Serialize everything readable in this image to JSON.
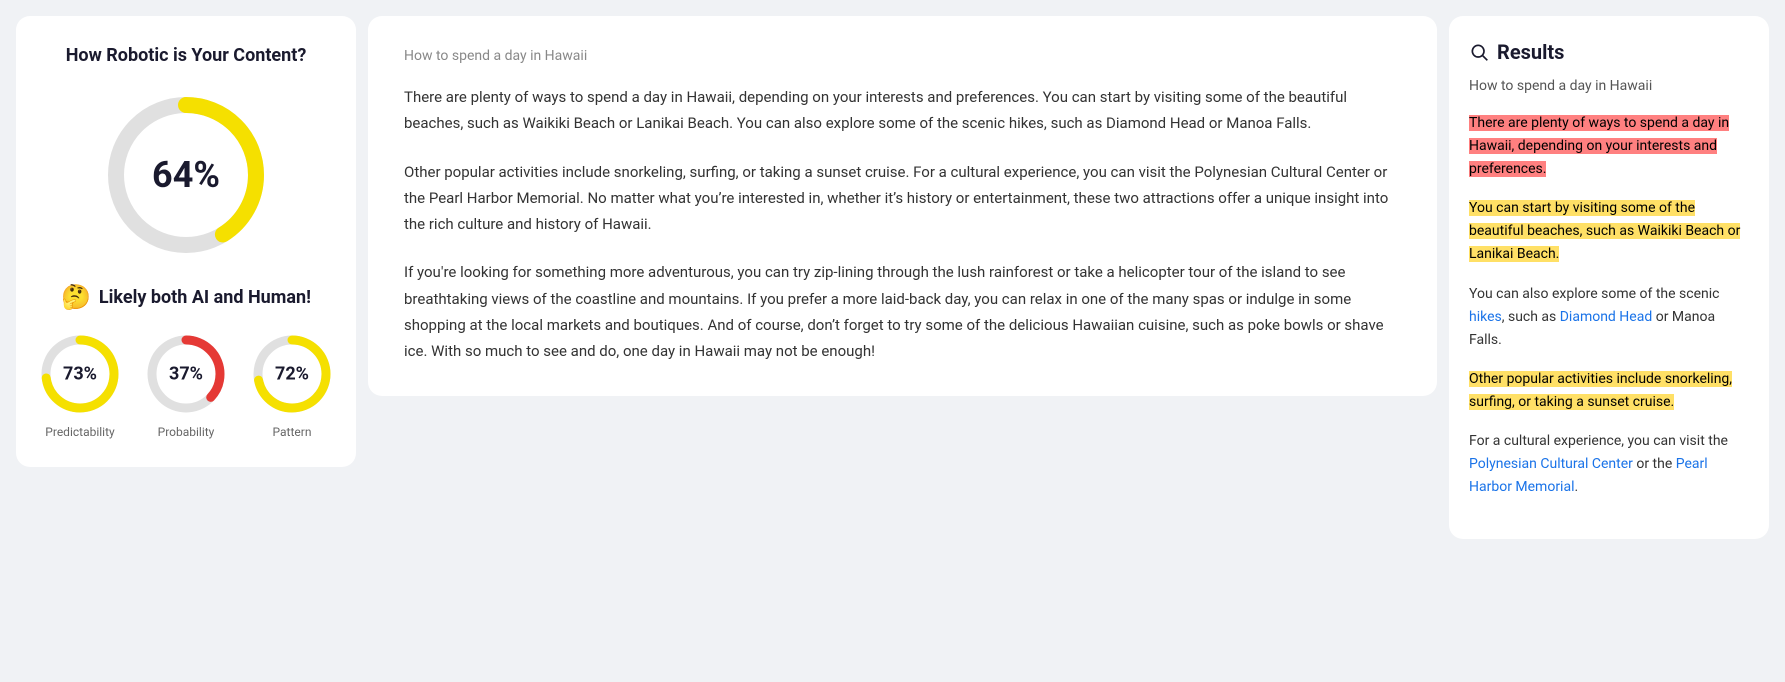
{
  "left": {
    "title": "How Robotic is Your Content?",
    "big_donut": {
      "percent": 64,
      "label": "64%",
      "color_fill": "#f5e000",
      "color_track": "#e0e0e0"
    },
    "result_label": "Likely both AI and Human!",
    "emoji": "🤔",
    "small_donuts": [
      {
        "id": "predictability",
        "label": "73%",
        "percent": 73,
        "name": "Predictability",
        "color": "#f5e000"
      },
      {
        "id": "probability",
        "label": "37%",
        "percent": 37,
        "name": "Probability",
        "color": "#e53935"
      },
      {
        "id": "pattern",
        "label": "72%",
        "percent": 72,
        "name": "Pattern",
        "color": "#f5e000"
      }
    ]
  },
  "middle": {
    "article_label": "How to spend a day in Hawaii",
    "paragraphs": [
      "There are plenty of ways to spend a day in Hawaii, depending on your interests and preferences. You can start by visiting some of the beautiful beaches, such as Waikiki Beach or Lanikai Beach. You can also explore some of the scenic hikes, such as Diamond Head or Manoa Falls.",
      "Other popular activities include snorkeling, surfing, or taking a sunset cruise. For a cultural experience, you can visit the Polynesian Cultural Center or the Pearl Harbor Memorial. No matter what you’re interested in, whether it’s history or entertainment, these two attractions offer a unique insight into the rich culture and history of Hawaii.",
      "If you're looking for something more adventurous, you can try zip-lining through the lush rainforest or take a helicopter tour of the island to see breathtaking views of the coastline and mountains. If you prefer a more laid-back day, you can relax in one of the many spas or indulge in some shopping at the local markets and boutiques. And of course, don’t forget to try some of the delicious Hawaiian cuisine, such as poke bowls or shave ice. With so much to see and do, one day in Hawaii may not be enough!"
    ]
  },
  "right": {
    "header": "Results",
    "query": "How to spend a day in Hawaii",
    "snippets": [
      {
        "id": "snippet-1",
        "highlight": "pink",
        "text": "There are plenty of ways to spend a day in Hawaii, depending on your interests and preferences."
      },
      {
        "id": "snippet-2",
        "highlight": "yellow",
        "text": "You can start by visiting some of the beautiful beaches, such as Waikiki Beach or Lanikai Beach."
      },
      {
        "id": "snippet-3",
        "highlight": "none",
        "text": "You can also explore some of the scenic hikes, such as Diamond Head or Manoa Falls."
      },
      {
        "id": "snippet-4",
        "highlight": "yellow",
        "text": "Other popular activities include snorkeling, surfing, or taking a sunset cruise."
      },
      {
        "id": "snippet-5",
        "highlight": "none",
        "text": "For a cultural experience, you can visit the Polynesian Cultural Center or the Pearl Harbor Memorial."
      }
    ]
  }
}
